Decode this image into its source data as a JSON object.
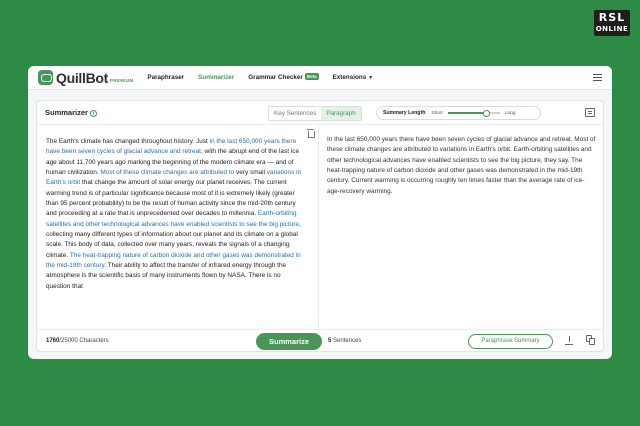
{
  "badge": {
    "line1": "RSL",
    "line2": "ONLINE"
  },
  "nav": {
    "logo": "QuillBot",
    "premium": "PREMIUM",
    "items": [
      "Paraphraser",
      "Summarizer",
      "Grammar Checker",
      "Extensions"
    ],
    "beta": "Beta",
    "active": "Summarizer"
  },
  "toolbar": {
    "title": "Summarizer",
    "modes": [
      "Key Sentences",
      "Paragraph"
    ],
    "active_mode": "Paragraph",
    "length_label": "Summary Length",
    "length_short": "Short",
    "length_long": "Long",
    "length_value": 0.75
  },
  "input": {
    "segments": [
      {
        "t": "The Earth's climate has changed throughout history. Just ",
        "h": false
      },
      {
        "t": "in the last 650,000 years there have been seven cycles of glacial advance and retreat",
        "h": true
      },
      {
        "t": ", with the abrupt end of the last ice age about 11,700 years ago marking the beginning of the modern climate era — and of human civilization. ",
        "h": false
      },
      {
        "t": "Most of these climate changes are attributed to",
        "h": true
      },
      {
        "t": " very small ",
        "h": false
      },
      {
        "t": "variations in Earth's orbit",
        "h": true
      },
      {
        "t": " that change the amount of solar energy our planet receives. The current warming trend is of particular significance because most of it is extremely likely (greater than 95 percent probability) to be the result of human activity since the mid-20th century and proceeding at a rate that is unprecedented over decades to millennia. ",
        "h": false
      },
      {
        "t": "Earth-orbiting satellites and other technological advances have enabled scientists to see the big picture",
        "h": true
      },
      {
        "t": ", collecting many different types of information about our planet and its climate on a global scale. This body of data, collected over many years, reveals the signals of a changing climate. ",
        "h": false
      },
      {
        "t": "The heat-trapping nature of carbon dioxide and other gases was demonstrated in the mid-19th century",
        "h": true
      },
      {
        "t": ". Their ability to affect the transfer of infrared energy through the atmosphere is the scientific basis of many instruments flown by NASA. There is no question that",
        "h": false
      }
    ],
    "char_count": "1760",
    "char_total": "/25000 Characters"
  },
  "output": {
    "text": "In the last 650,000 years there have been seven cycles of glacial advance and retreat. Most of these climate changes are attributed to variations in Earth's orbit. Earth-orbiting satellites and other technological advances have enabled scientists to see the big picture, they say. The heat-trapping nature of carbon dioxide and other gases was demonstrated in the mid-19th century. Current warming is occurring roughly ten times faster than the average rate of ice-age-recovery warming.",
    "sentence_count": "5",
    "sentence_label": " Sentences"
  },
  "buttons": {
    "summarize": "Summarize",
    "paraphrase_summary": "Paraphrase Summary"
  },
  "colors": {
    "brand": "#499557",
    "highlight": "#2a6db5",
    "background": "#2e8b45"
  },
  "icons": [
    "robot-logo-icon",
    "menu-icon",
    "info-icon",
    "comment-icon",
    "trash-icon",
    "download-icon",
    "copy-icon"
  ]
}
